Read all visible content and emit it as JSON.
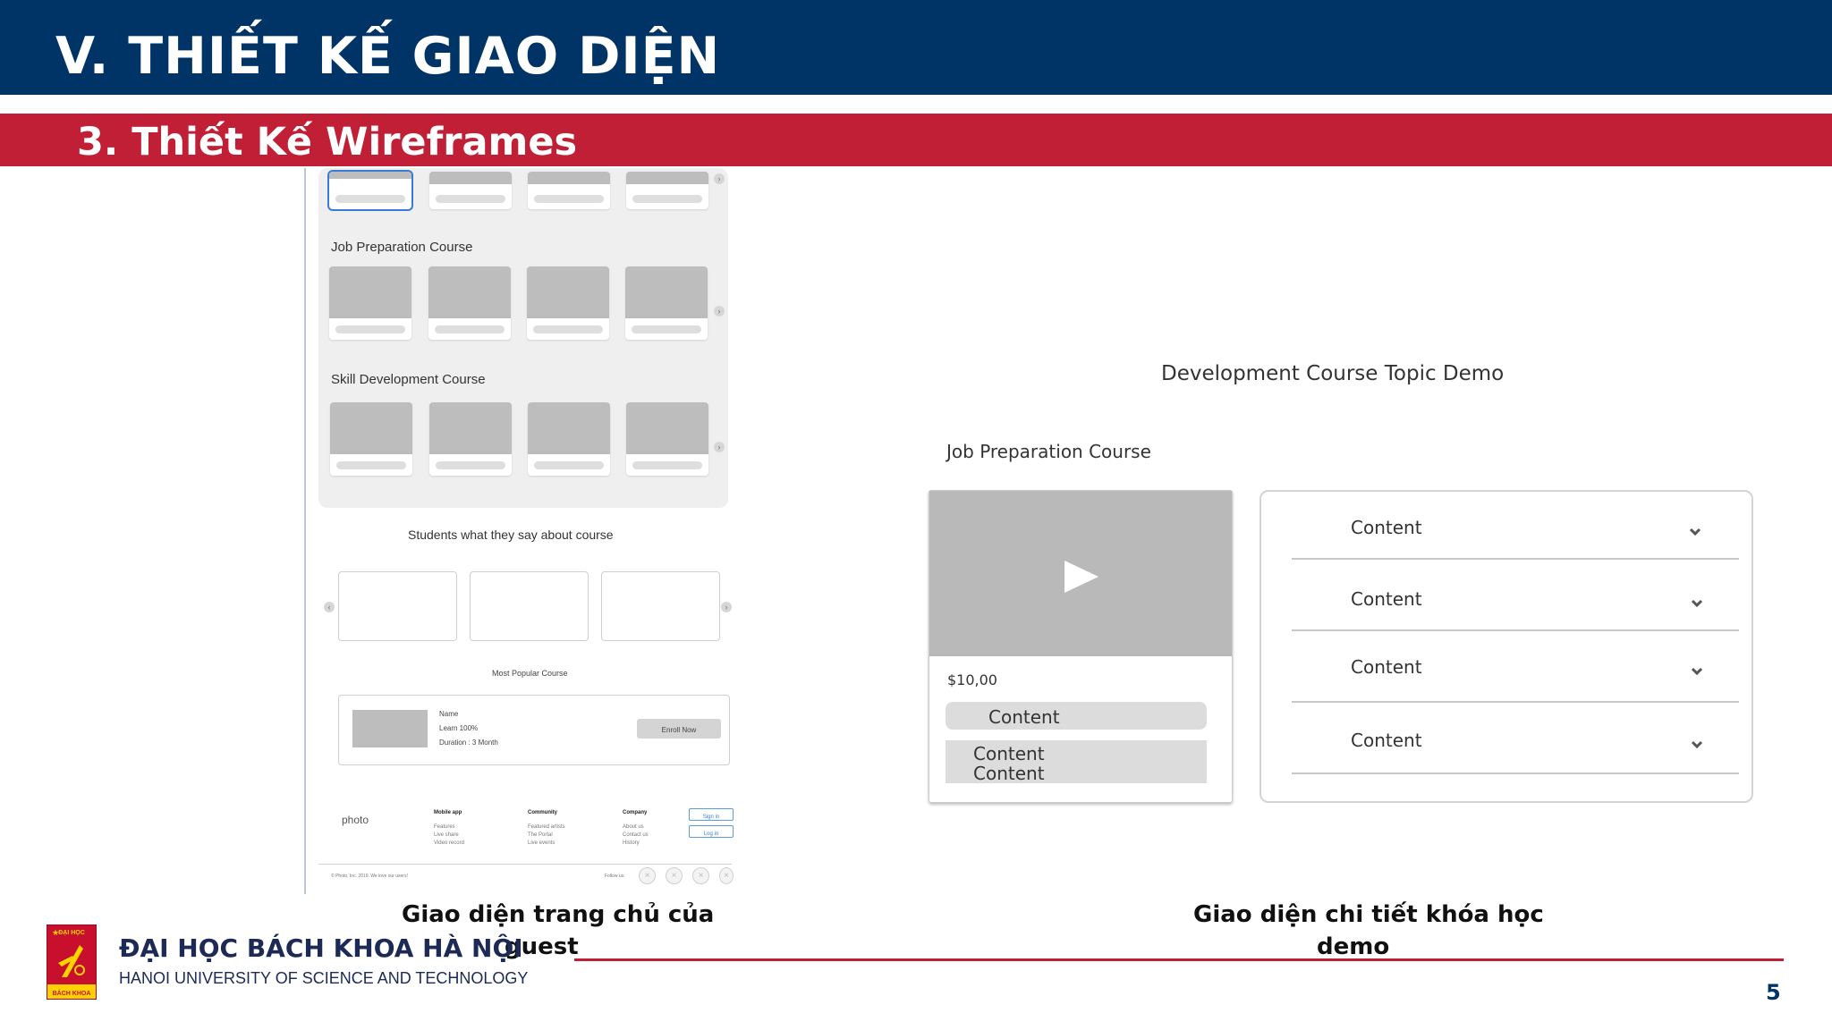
{
  "header": {
    "title": "V. THIẾT KẾ GIAO DIỆN",
    "subtitle": "3. Thiết Kế Wireframes"
  },
  "left_wireframe": {
    "section_job": "Job Preparation Course",
    "section_skill": "Skill Development Course",
    "testimonials_title": "Students what they say about course",
    "popular_title": "Most Popular Course",
    "popular_card": {
      "name": "Name",
      "learn": "Learn 100%",
      "duration": "Duration : 3 Month",
      "enroll_label": "Enroll Now"
    },
    "footer": {
      "photo": "photo",
      "col1_title": "Mobile app",
      "col1_items": [
        "Features",
        "Live share",
        "Video record"
      ],
      "col2_title": "Community",
      "col2_items": [
        "Featured artists",
        "The Portal",
        "Live events"
      ],
      "col3_title": "Company",
      "col3_items": [
        "About us",
        "Contact us",
        "History"
      ],
      "signin_label": "Sign in",
      "login_label": "Log in",
      "copyright": "© Photo, Inc. 2019. We love our users!",
      "follow": "Follow us:"
    }
  },
  "right_wireframe": {
    "topic_title": "Development  Course Topic Demo",
    "course_name": "Job Preparation Course",
    "price": "$10,00",
    "content_button": "Content",
    "content_block_line1": "Content",
    "content_block_line2": "Content",
    "accordion_items": [
      "Content",
      "Content",
      "Content",
      "Content"
    ]
  },
  "captions": {
    "left_line1": "Giao diện trang chủ của",
    "left_line2": "guest",
    "right_line1": "Giao diện  chi tiết khóa học",
    "right_line2": "demo"
  },
  "footer": {
    "university_vn": "ĐẠI HỌC BÁCH KHOA HÀ NỘI",
    "university_en": "HANOI UNIVERSITY OF SCIENCE AND TECHNOLOGY",
    "logo_top": "ĐẠI HỌC",
    "logo_bottom": "BÁCH KHOA",
    "page_number": "5"
  },
  "colors": {
    "navy": "#003366",
    "crimson": "#c01f35",
    "wire_gray": "#bdbdbd"
  }
}
